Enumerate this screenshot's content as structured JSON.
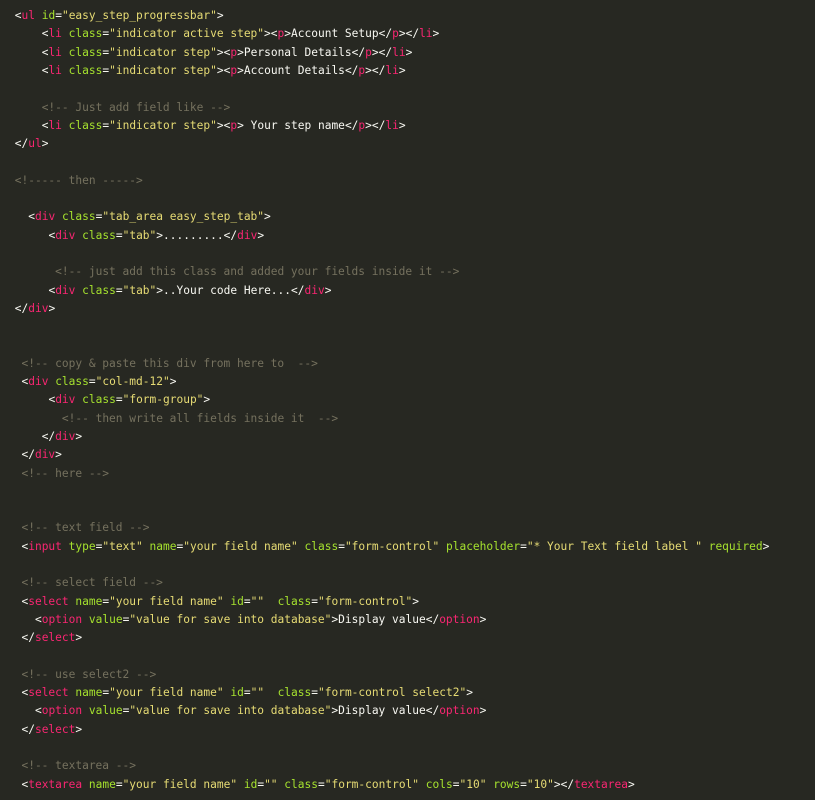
{
  "colors": {
    "background": "#272822",
    "tag": "#f92672",
    "attribute": "#a6e22e",
    "string": "#e6db74",
    "comment": "#75715e",
    "text": "#f8f8f2"
  },
  "code_lines": [
    {
      "indent": 1,
      "tokens": [
        [
          "punct",
          "<"
        ],
        [
          "tag",
          "ul"
        ],
        [
          "text",
          " "
        ],
        [
          "attr",
          "id"
        ],
        [
          "punct",
          "="
        ],
        [
          "str",
          "\"easy_step_progressbar\""
        ],
        [
          "punct",
          ">"
        ]
      ]
    },
    {
      "indent": 5,
      "tokens": [
        [
          "punct",
          "<"
        ],
        [
          "tag",
          "li"
        ],
        [
          "text",
          " "
        ],
        [
          "attr",
          "class"
        ],
        [
          "punct",
          "="
        ],
        [
          "str",
          "\"indicator active step\""
        ],
        [
          "punct",
          ">"
        ],
        [
          "punct",
          "<"
        ],
        [
          "tag",
          "p"
        ],
        [
          "punct",
          ">"
        ],
        [
          "text",
          "Account Setup"
        ],
        [
          "punct",
          "</"
        ],
        [
          "tag",
          "p"
        ],
        [
          "punct",
          ">"
        ],
        [
          "punct",
          "</"
        ],
        [
          "tag",
          "li"
        ],
        [
          "punct",
          ">"
        ]
      ]
    },
    {
      "indent": 5,
      "tokens": [
        [
          "punct",
          "<"
        ],
        [
          "tag",
          "li"
        ],
        [
          "text",
          " "
        ],
        [
          "attr",
          "class"
        ],
        [
          "punct",
          "="
        ],
        [
          "str",
          "\"indicator step\""
        ],
        [
          "punct",
          ">"
        ],
        [
          "punct",
          "<"
        ],
        [
          "tag",
          "p"
        ],
        [
          "punct",
          ">"
        ],
        [
          "text",
          "Personal Details"
        ],
        [
          "punct",
          "</"
        ],
        [
          "tag",
          "p"
        ],
        [
          "punct",
          ">"
        ],
        [
          "punct",
          "</"
        ],
        [
          "tag",
          "li"
        ],
        [
          "punct",
          ">"
        ]
      ]
    },
    {
      "indent": 5,
      "tokens": [
        [
          "punct",
          "<"
        ],
        [
          "tag",
          "li"
        ],
        [
          "text",
          " "
        ],
        [
          "attr",
          "class"
        ],
        [
          "punct",
          "="
        ],
        [
          "str",
          "\"indicator step\""
        ],
        [
          "punct",
          ">"
        ],
        [
          "punct",
          "<"
        ],
        [
          "tag",
          "p"
        ],
        [
          "punct",
          ">"
        ],
        [
          "text",
          "Account Details"
        ],
        [
          "punct",
          "</"
        ],
        [
          "tag",
          "p"
        ],
        [
          "punct",
          ">"
        ],
        [
          "punct",
          "</"
        ],
        [
          "tag",
          "li"
        ],
        [
          "punct",
          ">"
        ]
      ]
    },
    {
      "indent": 0,
      "tokens": []
    },
    {
      "indent": 5,
      "tokens": [
        [
          "cmt",
          "<!-- Just add field like -->"
        ]
      ]
    },
    {
      "indent": 5,
      "tokens": [
        [
          "punct",
          "<"
        ],
        [
          "tag",
          "li"
        ],
        [
          "text",
          " "
        ],
        [
          "attr",
          "class"
        ],
        [
          "punct",
          "="
        ],
        [
          "str",
          "\"indicator step\""
        ],
        [
          "punct",
          ">"
        ],
        [
          "punct",
          "<"
        ],
        [
          "tag",
          "p"
        ],
        [
          "punct",
          ">"
        ],
        [
          "text",
          " Your step name"
        ],
        [
          "punct",
          "</"
        ],
        [
          "tag",
          "p"
        ],
        [
          "punct",
          ">"
        ],
        [
          "punct",
          "</"
        ],
        [
          "tag",
          "li"
        ],
        [
          "punct",
          ">"
        ]
      ]
    },
    {
      "indent": 1,
      "tokens": [
        [
          "punct",
          "</"
        ],
        [
          "tag",
          "ul"
        ],
        [
          "punct",
          ">"
        ]
      ]
    },
    {
      "indent": 0,
      "tokens": []
    },
    {
      "indent": 1,
      "tokens": [
        [
          "cmt",
          "<!----- then ----->"
        ]
      ]
    },
    {
      "indent": 0,
      "tokens": []
    },
    {
      "indent": 3,
      "tokens": [
        [
          "punct",
          "<"
        ],
        [
          "tag",
          "div"
        ],
        [
          "text",
          " "
        ],
        [
          "attr",
          "class"
        ],
        [
          "punct",
          "="
        ],
        [
          "str",
          "\"tab_area easy_step_tab\""
        ],
        [
          "punct",
          ">"
        ]
      ]
    },
    {
      "indent": 6,
      "tokens": [
        [
          "punct",
          "<"
        ],
        [
          "tag",
          "div"
        ],
        [
          "text",
          " "
        ],
        [
          "attr",
          "class"
        ],
        [
          "punct",
          "="
        ],
        [
          "str",
          "\"tab\""
        ],
        [
          "punct",
          ">"
        ],
        [
          "text",
          "........."
        ],
        [
          "punct",
          "</"
        ],
        [
          "tag",
          "div"
        ],
        [
          "punct",
          ">"
        ]
      ]
    },
    {
      "indent": 0,
      "tokens": []
    },
    {
      "indent": 7,
      "tokens": [
        [
          "cmt",
          "<!-- just add this class and added your fields inside it -->"
        ]
      ]
    },
    {
      "indent": 6,
      "tokens": [
        [
          "punct",
          "<"
        ],
        [
          "tag",
          "div"
        ],
        [
          "text",
          " "
        ],
        [
          "attr",
          "class"
        ],
        [
          "punct",
          "="
        ],
        [
          "str",
          "\"tab\""
        ],
        [
          "punct",
          ">"
        ],
        [
          "text",
          "..Your code Here..."
        ],
        [
          "punct",
          "</"
        ],
        [
          "tag",
          "div"
        ],
        [
          "punct",
          ">"
        ]
      ]
    },
    {
      "indent": 1,
      "tokens": [
        [
          "punct",
          "</"
        ],
        [
          "tag",
          "div"
        ],
        [
          "punct",
          ">"
        ]
      ]
    },
    {
      "indent": 0,
      "tokens": []
    },
    {
      "indent": 0,
      "tokens": []
    },
    {
      "indent": 2,
      "tokens": [
        [
          "cmt",
          "<!-- copy & paste this div from here to  -->"
        ]
      ]
    },
    {
      "indent": 2,
      "tokens": [
        [
          "punct",
          "<"
        ],
        [
          "tag",
          "div"
        ],
        [
          "text",
          " "
        ],
        [
          "attr",
          "class"
        ],
        [
          "punct",
          "="
        ],
        [
          "str",
          "\"col-md-12\""
        ],
        [
          "punct",
          ">"
        ]
      ]
    },
    {
      "indent": 6,
      "tokens": [
        [
          "punct",
          "<"
        ],
        [
          "tag",
          "div"
        ],
        [
          "text",
          " "
        ],
        [
          "attr",
          "class"
        ],
        [
          "punct",
          "="
        ],
        [
          "str",
          "\"form-group\""
        ],
        [
          "punct",
          ">"
        ]
      ]
    },
    {
      "indent": 8,
      "tokens": [
        [
          "cmt",
          "<!-- then write all fields inside it  -->"
        ]
      ]
    },
    {
      "indent": 5,
      "tokens": [
        [
          "punct",
          "</"
        ],
        [
          "tag",
          "div"
        ],
        [
          "punct",
          ">"
        ]
      ]
    },
    {
      "indent": 2,
      "tokens": [
        [
          "punct",
          "</"
        ],
        [
          "tag",
          "div"
        ],
        [
          "punct",
          ">"
        ]
      ]
    },
    {
      "indent": 2,
      "tokens": [
        [
          "cmt",
          "<!-- here -->"
        ]
      ]
    },
    {
      "indent": 0,
      "tokens": []
    },
    {
      "indent": 0,
      "tokens": []
    },
    {
      "indent": 2,
      "tokens": [
        [
          "cmt",
          "<!-- text field -->"
        ]
      ]
    },
    {
      "indent": 2,
      "tokens": [
        [
          "punct",
          "<"
        ],
        [
          "tag",
          "input"
        ],
        [
          "text",
          " "
        ],
        [
          "attr",
          "type"
        ],
        [
          "punct",
          "="
        ],
        [
          "str",
          "\"text\""
        ],
        [
          "text",
          " "
        ],
        [
          "attr",
          "name"
        ],
        [
          "punct",
          "="
        ],
        [
          "str",
          "\"your field name\""
        ],
        [
          "text",
          " "
        ],
        [
          "attr",
          "class"
        ],
        [
          "punct",
          "="
        ],
        [
          "str",
          "\"form-control\""
        ],
        [
          "text",
          " "
        ],
        [
          "attr",
          "placeholder"
        ],
        [
          "punct",
          "="
        ],
        [
          "str",
          "\"* Your Text field label \""
        ],
        [
          "text",
          " "
        ],
        [
          "attr",
          "required"
        ],
        [
          "punct",
          ">"
        ]
      ]
    },
    {
      "indent": 0,
      "tokens": []
    },
    {
      "indent": 2,
      "tokens": [
        [
          "cmt",
          "<!-- select field -->"
        ]
      ]
    },
    {
      "indent": 2,
      "tokens": [
        [
          "punct",
          "<"
        ],
        [
          "tag",
          "select"
        ],
        [
          "text",
          " "
        ],
        [
          "attr",
          "name"
        ],
        [
          "punct",
          "="
        ],
        [
          "str",
          "\"your field name\""
        ],
        [
          "text",
          " "
        ],
        [
          "attr",
          "id"
        ],
        [
          "punct",
          "="
        ],
        [
          "str",
          "\"\""
        ],
        [
          "text",
          "  "
        ],
        [
          "attr",
          "class"
        ],
        [
          "punct",
          "="
        ],
        [
          "str",
          "\"form-control\""
        ],
        [
          "punct",
          ">"
        ]
      ]
    },
    {
      "indent": 4,
      "tokens": [
        [
          "punct",
          "<"
        ],
        [
          "tag",
          "option"
        ],
        [
          "text",
          " "
        ],
        [
          "attr",
          "value"
        ],
        [
          "punct",
          "="
        ],
        [
          "str",
          "\"value for save into database\""
        ],
        [
          "punct",
          ">"
        ],
        [
          "text",
          "Display value"
        ],
        [
          "punct",
          "</"
        ],
        [
          "tag",
          "option"
        ],
        [
          "punct",
          ">"
        ]
      ]
    },
    {
      "indent": 2,
      "tokens": [
        [
          "punct",
          "</"
        ],
        [
          "tag",
          "select"
        ],
        [
          "punct",
          ">"
        ]
      ]
    },
    {
      "indent": 0,
      "tokens": []
    },
    {
      "indent": 2,
      "tokens": [
        [
          "cmt",
          "<!-- use select2 -->"
        ]
      ]
    },
    {
      "indent": 2,
      "tokens": [
        [
          "punct",
          "<"
        ],
        [
          "tag",
          "select"
        ],
        [
          "text",
          " "
        ],
        [
          "attr",
          "name"
        ],
        [
          "punct",
          "="
        ],
        [
          "str",
          "\"your field name\""
        ],
        [
          "text",
          " "
        ],
        [
          "attr",
          "id"
        ],
        [
          "punct",
          "="
        ],
        [
          "str",
          "\"\""
        ],
        [
          "text",
          "  "
        ],
        [
          "attr",
          "class"
        ],
        [
          "punct",
          "="
        ],
        [
          "str",
          "\"form-control select2\""
        ],
        [
          "punct",
          ">"
        ]
      ]
    },
    {
      "indent": 4,
      "tokens": [
        [
          "punct",
          "<"
        ],
        [
          "tag",
          "option"
        ],
        [
          "text",
          " "
        ],
        [
          "attr",
          "value"
        ],
        [
          "punct",
          "="
        ],
        [
          "str",
          "\"value for save into database\""
        ],
        [
          "punct",
          ">"
        ],
        [
          "text",
          "Display value"
        ],
        [
          "punct",
          "</"
        ],
        [
          "tag",
          "option"
        ],
        [
          "punct",
          ">"
        ]
      ]
    },
    {
      "indent": 2,
      "tokens": [
        [
          "punct",
          "</"
        ],
        [
          "tag",
          "select"
        ],
        [
          "punct",
          ">"
        ]
      ]
    },
    {
      "indent": 0,
      "tokens": []
    },
    {
      "indent": 2,
      "tokens": [
        [
          "cmt",
          "<!-- textarea -->"
        ]
      ]
    },
    {
      "indent": 2,
      "tokens": [
        [
          "punct",
          "<"
        ],
        [
          "tag",
          "textarea"
        ],
        [
          "text",
          " "
        ],
        [
          "attr",
          "name"
        ],
        [
          "punct",
          "="
        ],
        [
          "str",
          "\"your field name\""
        ],
        [
          "text",
          " "
        ],
        [
          "attr",
          "id"
        ],
        [
          "punct",
          "="
        ],
        [
          "str",
          "\"\""
        ],
        [
          "text",
          " "
        ],
        [
          "attr",
          "class"
        ],
        [
          "punct",
          "="
        ],
        [
          "str",
          "\"form-control\""
        ],
        [
          "text",
          " "
        ],
        [
          "attr",
          "cols"
        ],
        [
          "punct",
          "="
        ],
        [
          "str",
          "\"10\""
        ],
        [
          "text",
          " "
        ],
        [
          "attr",
          "rows"
        ],
        [
          "punct",
          "="
        ],
        [
          "str",
          "\"10\""
        ],
        [
          "punct",
          ">"
        ],
        [
          "punct",
          "</"
        ],
        [
          "tag",
          "textarea"
        ],
        [
          "punct",
          ">"
        ]
      ]
    }
  ]
}
